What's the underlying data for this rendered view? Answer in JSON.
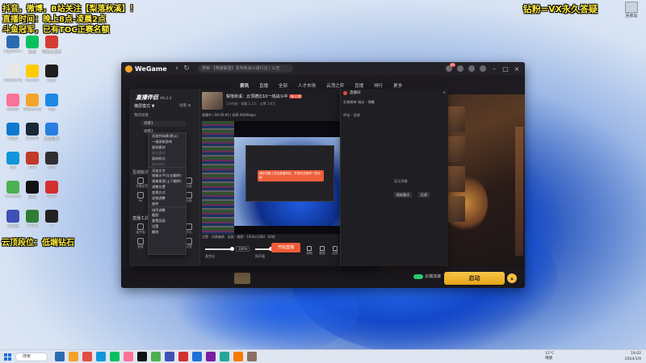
{
  "overlay": {
    "line1": "抖音，微博，B站关注【梨落秋溪】！",
    "line2": "直播时间：晚上8点-凌晨2点",
    "line3": "斗鱼冠军，已有TOC正赛名额",
    "right": "钻粉=VX永久答疑",
    "rank": "云顶段位：低端钻石"
  },
  "desktop": {
    "recycle_bin": "回收站",
    "icons": [
      {
        "label": "Logitech G HUB",
        "color": "#2b6cb0"
      },
      {
        "label": "微信",
        "color": "#07c160"
      },
      {
        "label": "网易云音乐",
        "color": "#d43c33"
      },
      {
        "label": "Moments",
        "color": "#e8e8e8"
      },
      {
        "label": "hunter",
        "color": "#ffcc00"
      },
      {
        "label": "Logo",
        "color": "#1f1f1f"
      },
      {
        "label": "Bilibili",
        "color": "#fb7299"
      },
      {
        "label": "WeGame",
        "color": "#f3a32a"
      },
      {
        "label": "Top",
        "color": "#1e88e5"
      },
      {
        "label": "Edge",
        "color": "#0f79d0"
      },
      {
        "label": "Steam",
        "color": "#1b2838"
      },
      {
        "label": "云顶助手",
        "color": "#2a7de1"
      },
      {
        "label": "QQ",
        "color": "#1296db"
      },
      {
        "label": "MSI",
        "color": "#c0392b"
      },
      {
        "label": "OBS",
        "color": "#302e31"
      },
      {
        "label": "Chrome",
        "color": "#4caf50"
      },
      {
        "label": "剪映",
        "color": "#111111"
      },
      {
        "label": "WPS",
        "color": "#d32f2f"
      },
      {
        "label": "小鹅通",
        "color": "#3f51b5"
      },
      {
        "label": "CODE",
        "color": "#2e7d32"
      },
      {
        "label": "Z",
        "color": "#222222"
      }
    ]
  },
  "wegame": {
    "title": "WeGame",
    "search_placeholder": "搜索 【英雄联盟】发布新战斗通行证 | 公告",
    "menu": [
      "资讯",
      "直播",
      "全部",
      "人才市场",
      "云顶之弈",
      "直播",
      "排行",
      "更多"
    ],
    "launch_label": "启动",
    "cloud_label": "云端加速",
    "side_text": "暂无内容",
    "side_btn1": "刷新重试",
    "side_btn2": "反馈",
    "notif_count": "99"
  },
  "zhibo": {
    "app_name": "直播伴侣",
    "version": "V9.2.3",
    "mode_label": "横屏模式 ▼",
    "mode_right": "场景  ⚙",
    "scene_head": "我的场景",
    "scenes": [
      "场景1",
      "场景2"
    ],
    "section_interact": "互动玩法",
    "section_tools": "直播工具",
    "tools_grid": [
      "开播设置",
      "连麦",
      "PK",
      "贴纸",
      "画中画",
      "音乐",
      "投屏",
      "设置"
    ],
    "stream_title": "梨落秋溪：云顶德比10一线战斗中",
    "stream_badge": "新人榜",
    "stream_sub": "1小时前 · 观看 1.2万 · 点赞 3.6万",
    "stats": "直播中 | 00:00:00 | 码率 6000kbps",
    "toast_text": "请在电脑上开启直播伴侣，不然无法使用一些功能",
    "bottom_bar": "设置  ·  场景编辑  ·  画面  ·  美颜  ·  1920x1080  ·  60帧",
    "mic_label": "麦克风",
    "mic_pct": "100%",
    "spk_label": "扬声器",
    "spk_pct": "57%",
    "ctl_icons": [
      "录制",
      "截图",
      "设置"
    ],
    "start_label": "开始直播"
  },
  "context_menu": {
    "items": [
      {
        "label": "添加到场景(默认)",
        "disabled": false
      },
      {
        "label": "一键录制游戏",
        "disabled": false
      },
      {
        "label": "复制素材",
        "disabled": false
      },
      {
        "label": "粘贴素材",
        "disabled": true
      },
      {
        "label": "复制样式",
        "disabled": false
      },
      {
        "label": "粘贴样式",
        "disabled": true
      },
      {
        "label": "添加文字",
        "disabled": false,
        "sep": true
      },
      {
        "label": "镜像水平(左右翻转)",
        "disabled": false
      },
      {
        "label": "镜像垂直(上下翻转)",
        "disabled": false
      },
      {
        "label": "调整位置",
        "disabled": false
      },
      {
        "label": "变换方式",
        "disabled": false
      },
      {
        "label": "滤镜调整",
        "disabled": false
      },
      {
        "label": "旋转",
        "disabled": false
      },
      {
        "label": "排序调整",
        "disabled": false,
        "sep": true
      },
      {
        "label": "截图",
        "disabled": false
      },
      {
        "label": "重置画面",
        "disabled": false
      },
      {
        "label": "设置",
        "disabled": false
      },
      {
        "label": "删除",
        "disabled": false
      }
    ]
  },
  "chat": {
    "title": "直播间",
    "tab_row1": "礼物榜单  观众  ·  弹幕",
    "tab_row2": "评论  ·  全部",
    "empty": "暂无弹幕",
    "btn1": "刷新重试",
    "btn2": "反馈"
  },
  "taskbar": {
    "search": "搜索",
    "weather_temp": "12°C",
    "weather_desc": "晴朗",
    "time": "19:02",
    "date": "2024/1/9",
    "app_colors": [
      "#2b6cb0",
      "#f3a32a",
      "#e04f3f",
      "#1296db",
      "#07c160",
      "#fb7299",
      "#111111",
      "#4caf50",
      "#3f51b5",
      "#d32f2f",
      "#1f6fd9",
      "#7b1fa2",
      "#26a69a",
      "#f57c00",
      "#8d6e63"
    ]
  }
}
